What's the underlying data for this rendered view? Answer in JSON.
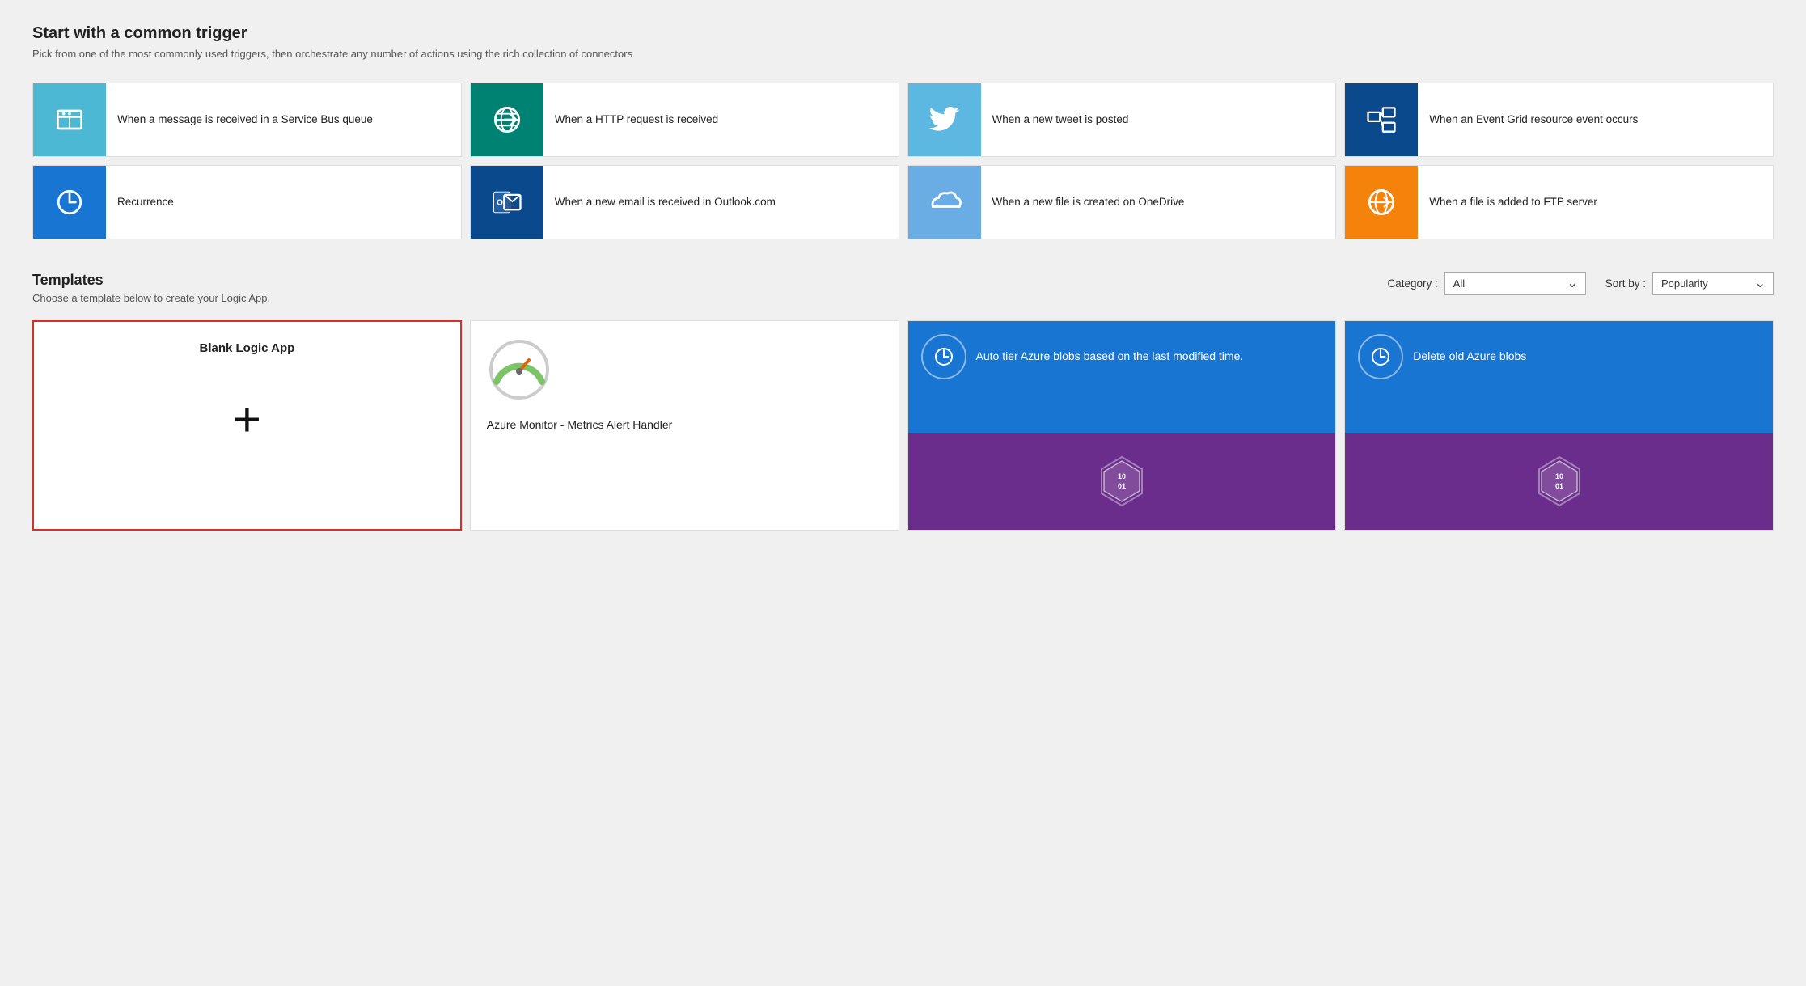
{
  "page": {
    "title": "Start with a common trigger",
    "subtitle": "Pick from one of the most commonly used triggers, then orchestrate any number of actions using the rich collection of connectors"
  },
  "triggers": [
    {
      "id": "service-bus",
      "label": "When a message is received in a Service Bus queue",
      "icon_color": "light-blue",
      "icon_type": "service-bus"
    },
    {
      "id": "http",
      "label": "When a HTTP request is received",
      "icon_color": "teal",
      "icon_type": "http"
    },
    {
      "id": "twitter",
      "label": "When a new tweet is posted",
      "icon_color": "twitter-blue",
      "icon_type": "twitter"
    },
    {
      "id": "event-grid",
      "label": "When an Event Grid resource event occurs",
      "icon_color": "dark-blue",
      "icon_type": "event-grid"
    },
    {
      "id": "recurrence",
      "label": "Recurrence",
      "icon_color": "blue",
      "icon_type": "recurrence"
    },
    {
      "id": "outlook",
      "label": "When a new email is received in Outlook.com",
      "icon_color": "outlook-blue",
      "icon_type": "outlook"
    },
    {
      "id": "onedrive",
      "label": "When a new file is created on OneDrive",
      "icon_color": "onedrive-blue",
      "icon_type": "onedrive"
    },
    {
      "id": "ftp",
      "label": "When a file is added to FTP server",
      "icon_color": "orange",
      "icon_type": "ftp"
    }
  ],
  "templates_section": {
    "title": "Templates",
    "subtitle": "Choose a template below to create your Logic App.",
    "category_label": "Category :",
    "category_value": "All",
    "sortby_label": "Sort by :",
    "sortby_value": "Popularity"
  },
  "templates": [
    {
      "id": "blank",
      "title": "Blank Logic App",
      "type": "blank"
    },
    {
      "id": "monitor",
      "title": "Azure Monitor - Metrics Alert Handler",
      "type": "monitor"
    },
    {
      "id": "auto-tier",
      "title": "Auto tier Azure blobs based on the last modified time.",
      "type": "two-color",
      "top_color": "#1875d2",
      "bottom_color": "#6b2d8b"
    },
    {
      "id": "delete-blobs",
      "title": "Delete old Azure blobs",
      "type": "two-color",
      "top_color": "#1875d2",
      "bottom_color": "#6b2d8b"
    }
  ]
}
